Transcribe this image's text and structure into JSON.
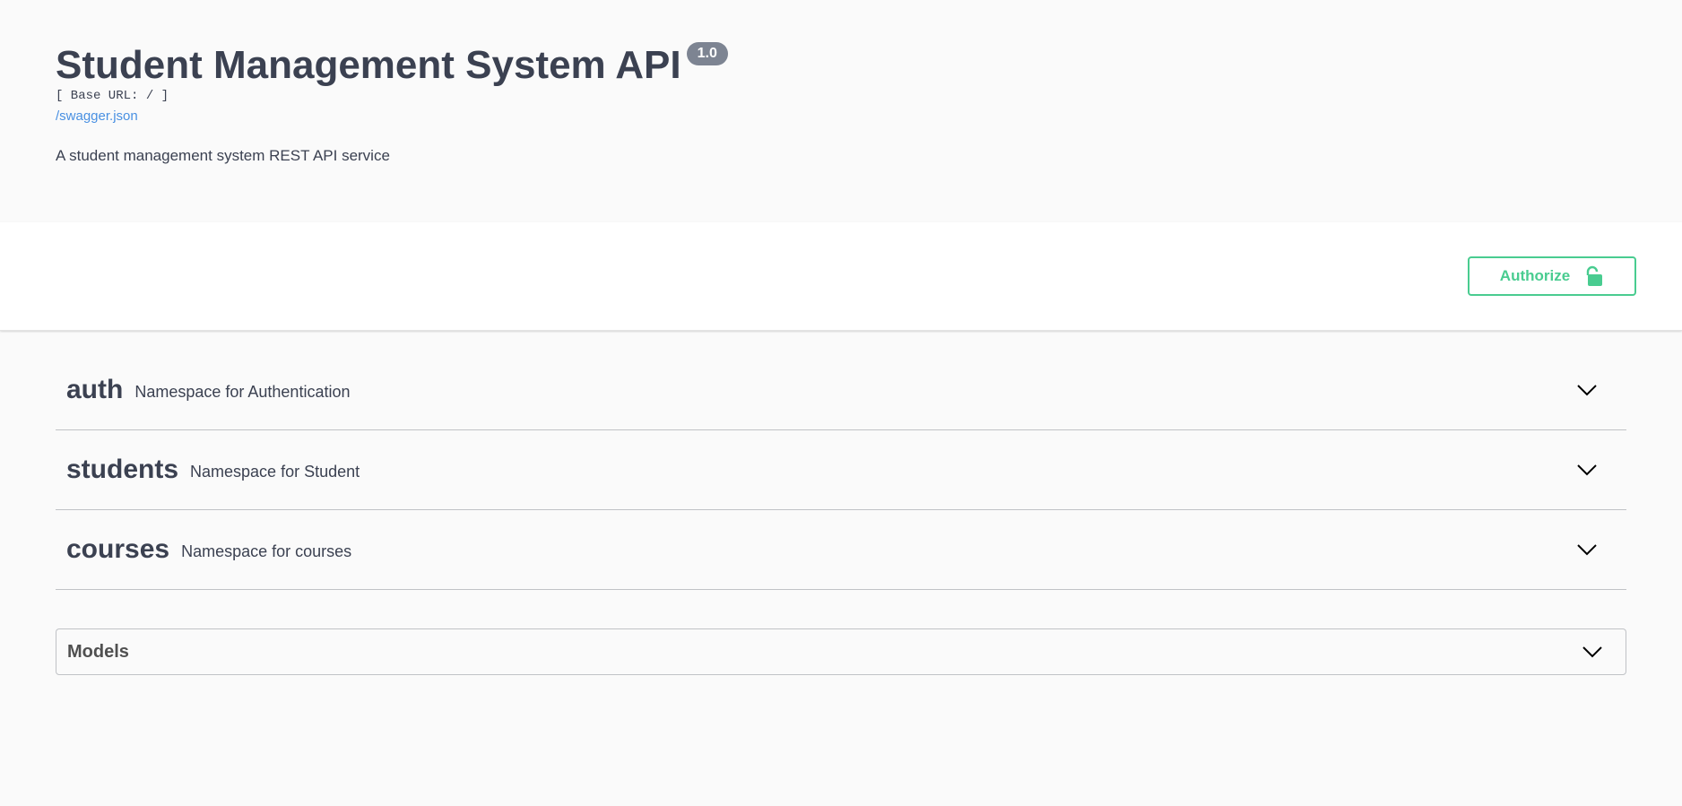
{
  "info": {
    "title": "Student Management System API",
    "version": "1.0",
    "base_url": "[ Base URL: / ]",
    "spec_link": "/swagger.json",
    "description": "A student management system REST API service"
  },
  "scheme": {
    "authorize_label": "Authorize",
    "authorize_icon": "unlock-icon",
    "accent_color": "#49cc90"
  },
  "tags": [
    {
      "name": "auth",
      "description": "Namespace for Authentication"
    },
    {
      "name": "students",
      "description": "Namespace for Student"
    },
    {
      "name": "courses",
      "description": "Namespace for courses"
    }
  ],
  "models": {
    "title": "Models"
  }
}
